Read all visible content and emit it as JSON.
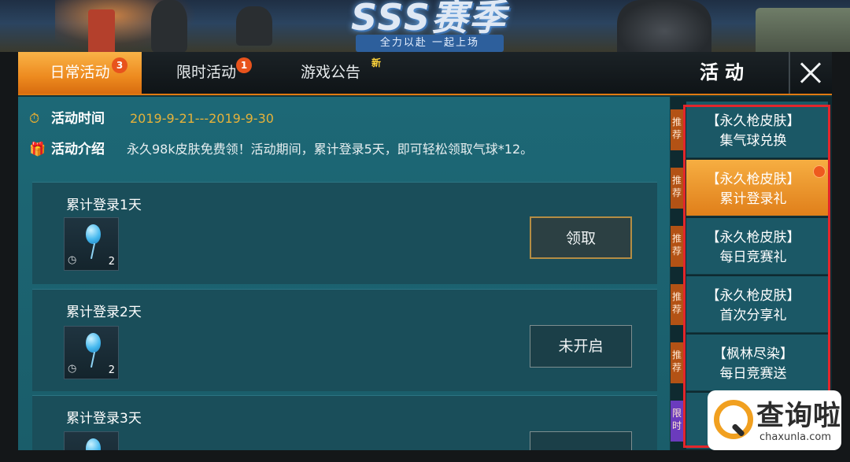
{
  "banner": {
    "title": "SSS赛季",
    "slogan": "全力以赴 一起上场"
  },
  "tabs": [
    {
      "label": "日常活动",
      "badge": "3",
      "active": true
    },
    {
      "label": "限时活动",
      "badge": "1",
      "active": false
    },
    {
      "label": "游戏公告",
      "tag": "新",
      "active": false
    }
  ],
  "header": {
    "title": "活动",
    "close_icon": "close-icon"
  },
  "info": {
    "time_label": "活动时间",
    "time_value": "2019-9-21---2019-9-30",
    "intro_label": "活动介绍",
    "intro_value": "永久98k皮肤免费领！活动期间，累计登录5天，即可轻松领取气球*12。",
    "time_icon": "stopwatch-icon",
    "intro_icon": "gift-icon"
  },
  "rewards": [
    {
      "title": "累计登录1天",
      "count": "2",
      "button": "领取",
      "item_icon": "balloon-icon"
    },
    {
      "title": "累计登录2天",
      "count": "2",
      "button": "未开启",
      "item_icon": "balloon-icon"
    },
    {
      "title": "累计登录3天",
      "count": "",
      "button": "",
      "item_icon": "balloon-icon"
    }
  ],
  "sidebar": {
    "items": [
      {
        "tag": "推荐",
        "line1": "【永久枪皮肤】",
        "line2": "集气球兑换",
        "active": false
      },
      {
        "tag": "推荐",
        "line1": "【永久枪皮肤】",
        "line2": "累计登录礼",
        "active": true
      },
      {
        "tag": "推荐",
        "line1": "【永久枪皮肤】",
        "line2": "每日竞赛礼",
        "active": false
      },
      {
        "tag": "推荐",
        "line1": "【永久枪皮肤】",
        "line2": "首次分享礼",
        "active": false
      },
      {
        "tag": "推荐",
        "line1": "【枫林尽染】",
        "line2": "每日竞赛送",
        "active": false
      },
      {
        "tag": "限时",
        "line1": "",
        "line2": "",
        "active": false
      }
    ]
  },
  "watermark": {
    "name": "查询啦",
    "domain": "chaxunla.com"
  },
  "colors": {
    "accent": "#ed8a1f",
    "highlight": "#e3262b",
    "panel": "#1d6876",
    "date": "#e6b23a"
  }
}
